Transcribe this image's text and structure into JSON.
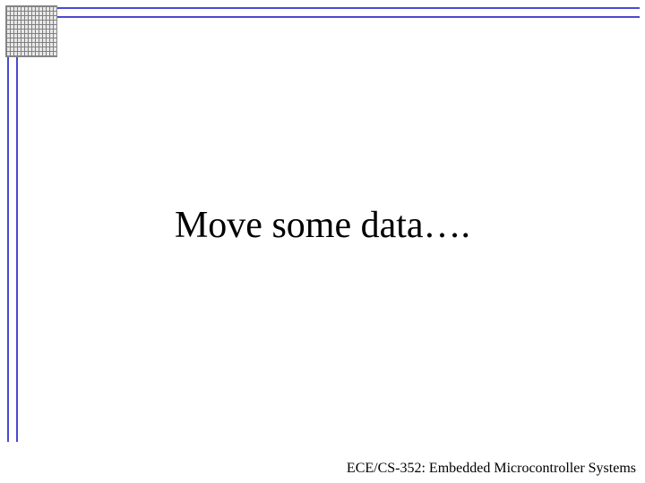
{
  "slide": {
    "title": "Move some data….",
    "footer": "ECE/CS-352: Embedded Microcontroller Systems"
  }
}
